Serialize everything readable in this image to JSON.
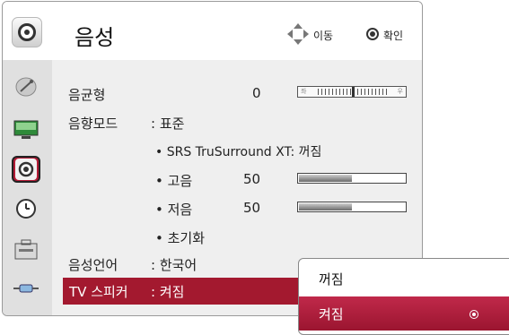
{
  "header": {
    "title": "음성",
    "move_hint": "이동",
    "ok_hint": "확인",
    "icon": "speaker-icon"
  },
  "sidebar": {
    "items": [
      {
        "icon": "satellite-dish-icon"
      },
      {
        "icon": "monitor-icon"
      },
      {
        "icon": "speaker-icon",
        "selected": true
      },
      {
        "icon": "clock-icon"
      },
      {
        "icon": "toolbox-icon"
      },
      {
        "icon": "cable-icon"
      }
    ]
  },
  "menu": {
    "balance_label": "음균형",
    "balance_value": "0",
    "balance_left": "좌",
    "balance_right": "우",
    "balance_fraction": 0.5,
    "sound_mode_label": "음향모드",
    "sound_mode_value": ": 표준",
    "srs_label": "• SRS TruSurround XT: 꺼짐",
    "treble_label": "• 고음",
    "treble_value": "50",
    "treble_fraction": 0.5,
    "bass_label": "• 저음",
    "bass_value": "50",
    "bass_fraction": 0.5,
    "reset_label": "• 초기화",
    "audio_lang_label": "음성언어",
    "audio_lang_value": ": 한국어",
    "tv_speaker_label": "TV 스피커",
    "tv_speaker_value": ": 켜짐"
  },
  "popup": {
    "options": [
      "꺼짐",
      "켜짐"
    ],
    "selected": "켜짐"
  },
  "colors": {
    "accent": "#a3192f",
    "sidebar_bg": "#e0e0e0",
    "body_bg": "#efefef"
  }
}
